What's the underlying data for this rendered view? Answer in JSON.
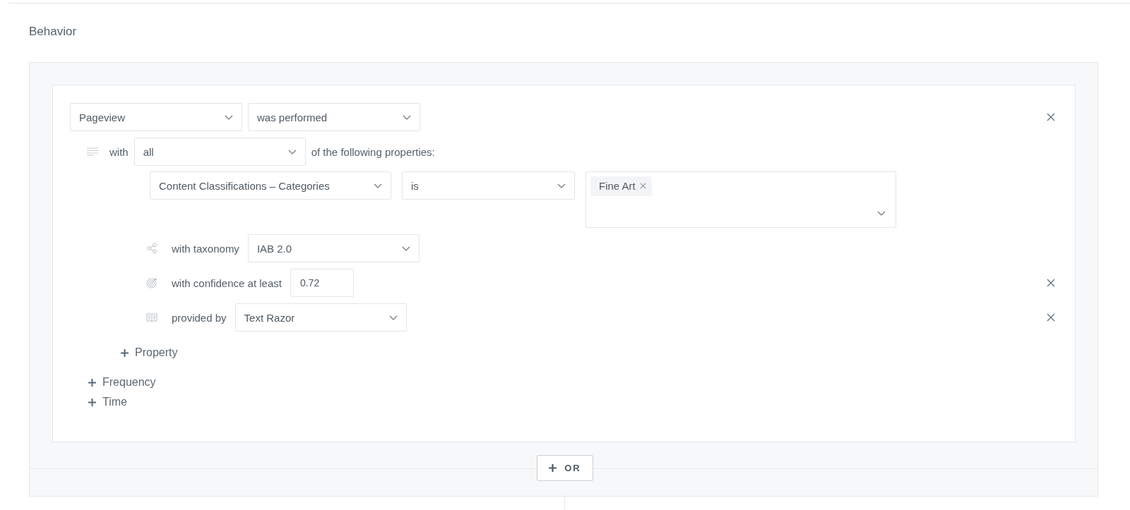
{
  "section_title": "Behavior",
  "condition": {
    "event": "Pageview",
    "operator": "was performed",
    "removable": true,
    "match_prefix": "with",
    "match": "all",
    "match_suffix": "of the following properties:",
    "property": {
      "name": "Content Classifications – Categories",
      "operator": "is",
      "values": [
        "Fine Art"
      ]
    },
    "qualifiers": [
      {
        "kind": "select",
        "label": "with taxonomy",
        "value": "IAB 2.0",
        "removable": false
      },
      {
        "kind": "input",
        "label": "with confidence at least",
        "value": "0.72",
        "removable": true
      },
      {
        "kind": "select",
        "label": "provided by",
        "value": "Text Razor",
        "removable": true
      }
    ],
    "add_property": "Property"
  },
  "add_links": [
    "Frequency",
    "Time"
  ],
  "or_button": "OR"
}
